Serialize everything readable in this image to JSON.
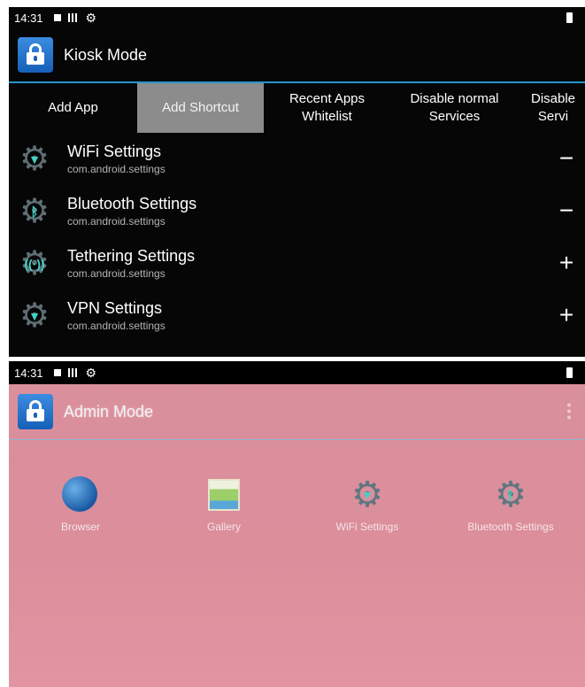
{
  "kiosk": {
    "status_time": "14:31",
    "title": "Kiosk Mode",
    "tabs": [
      {
        "label": "Add App"
      },
      {
        "label": "Add Shortcut"
      },
      {
        "label": "Recent Apps\nWhitelist"
      },
      {
        "label": "Disable normal\nServices"
      },
      {
        "label": "Disable\nServi"
      }
    ],
    "selected_tab": "Add Shortcut",
    "rows": [
      {
        "title": "WiFi Settings",
        "package": "com.android.settings",
        "action": "−",
        "icon": "wifi-settings-icon"
      },
      {
        "title": "Bluetooth Settings",
        "package": "com.android.settings",
        "action": "−",
        "icon": "bluetooth-settings-icon"
      },
      {
        "title": "Tethering Settings",
        "package": "com.android.settings",
        "action": "+",
        "icon": "tethering-settings-icon"
      },
      {
        "title": "VPN Settings",
        "package": "com.android.settings",
        "action": "+",
        "icon": "vpn-settings-icon"
      }
    ]
  },
  "admin": {
    "status_time": "14:31",
    "title": "Admin Mode",
    "apps": [
      {
        "label": "Browser",
        "icon": "browser-icon"
      },
      {
        "label": "Gallery",
        "icon": "gallery-icon"
      },
      {
        "label": "WiFi Settings",
        "icon": "wifi-settings-icon"
      },
      {
        "label": "Bluetooth Settings",
        "icon": "bluetooth-settings-icon"
      }
    ]
  },
  "colors": {
    "accent": "#2a93c8",
    "selected_tab_bg": "#8c8c8c",
    "admin_background": "#dc8e9b",
    "setting_icon_symbol": "#40d2c4"
  }
}
